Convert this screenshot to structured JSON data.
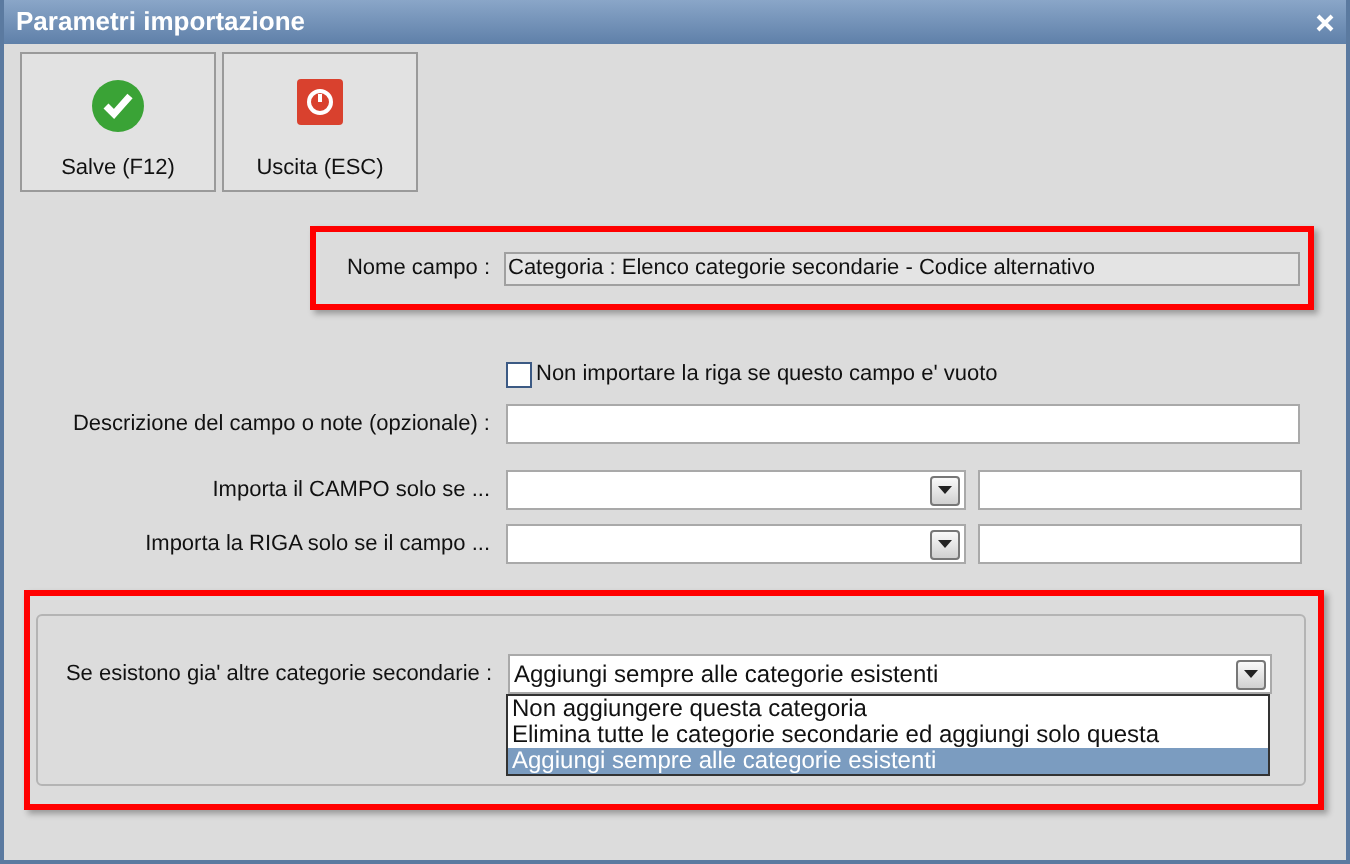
{
  "window": {
    "title": "Parametri importazione"
  },
  "toolbar": [
    {
      "label": "Salve (F12)",
      "kind": "save"
    },
    {
      "label": "Uscita (ESC)",
      "kind": "exit"
    }
  ],
  "field_name": {
    "label": "Nome campo :",
    "value": "Categoria : Elenco categorie secondarie - Codice alternativo",
    "highlighted": true
  },
  "skip_empty": {
    "label": "Non importare la riga se questo campo e' vuoto",
    "checked": false
  },
  "description": {
    "label": "Descrizione del campo o note (opzionale) :"
  },
  "conditions": [
    {
      "label": "Importa il CAMPO solo se ..."
    },
    {
      "label": "Importa la RIGA solo se il campo ..."
    }
  ],
  "existing": {
    "label": "Se esistono gia' altre categorie secondarie :",
    "value": "Aggiungi sempre alle categorie esistenti",
    "expanded": true,
    "highlighted": true,
    "options": [
      {
        "label": "Non aggiungere questa categoria",
        "selected": false
      },
      {
        "label": "Elimina tutte le categorie secondarie ed aggiungi solo questa",
        "selected": false
      },
      {
        "label": "Aggiungi sempre alle categorie esistenti",
        "selected": true
      }
    ]
  }
}
